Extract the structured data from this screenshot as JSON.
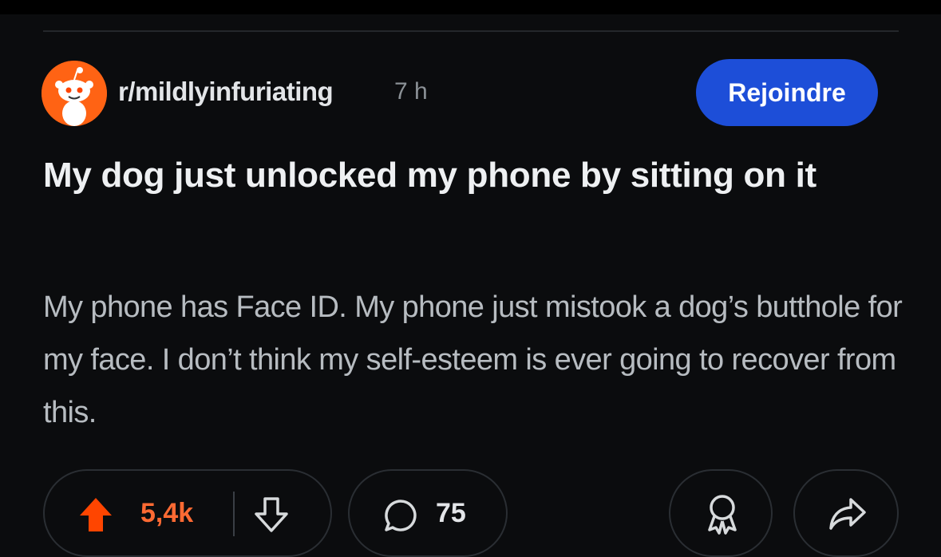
{
  "post": {
    "subreddit": "r/mildlyinfuriating",
    "age": "7 h",
    "join_label": "Rejoindre",
    "title": "My dog just unlocked my phone by sitting on it",
    "body": "My phone has Face ID. My phone just mistook a dog’s butthole for my face. I don’t think my self-esteem is ever going to recover from this."
  },
  "actions": {
    "votes": "5,4k",
    "comments": "75"
  },
  "colors": {
    "background": "#0b0c0e",
    "join_button": "#1d4ed8",
    "upvote": "#ff4500",
    "vote_count": "#ff6a33"
  },
  "icons": [
    "reddit-snoo-avatar",
    "upvote-icon",
    "downvote-icon",
    "comment-icon",
    "award-icon",
    "share-icon"
  ]
}
